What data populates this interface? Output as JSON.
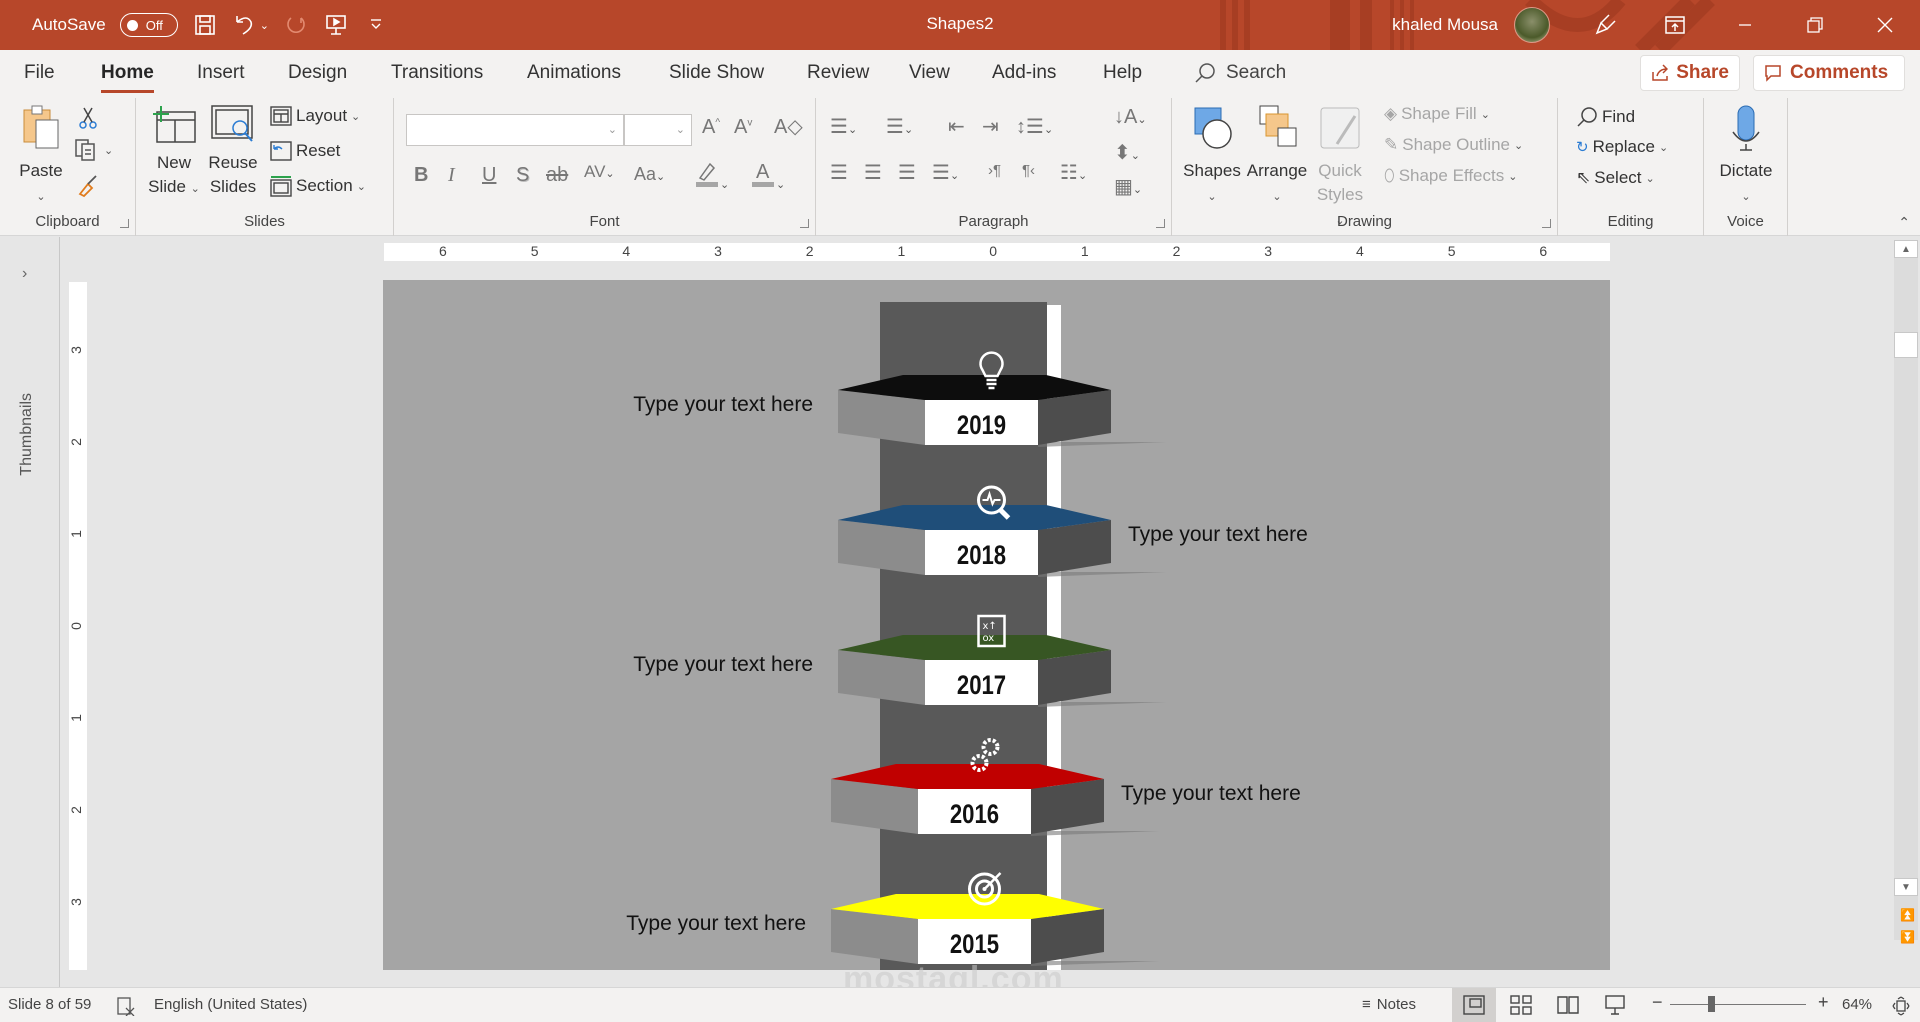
{
  "titlebar": {
    "autosave_label": "AutoSave",
    "autosave_state": "Off",
    "doc_title": "Shapes2",
    "user_name": "khaled Mousa",
    "brand_color": "#b7472a"
  },
  "tabs": [
    {
      "label": "File"
    },
    {
      "label": "Home",
      "active": true
    },
    {
      "label": "Insert"
    },
    {
      "label": "Design"
    },
    {
      "label": "Transitions"
    },
    {
      "label": "Animations"
    },
    {
      "label": "Slide Show"
    },
    {
      "label": "Review"
    },
    {
      "label": "View"
    },
    {
      "label": "Add-ins"
    },
    {
      "label": "Help"
    }
  ],
  "search": {
    "label": "Search"
  },
  "share_label": "Share",
  "comments_label": "Comments",
  "ribbon": {
    "clipboard": {
      "label": "Clipboard",
      "paste": "Paste"
    },
    "slides": {
      "label": "Slides",
      "new_slide_1": "New",
      "new_slide_2": "Slide",
      "reuse_1": "Reuse",
      "reuse_2": "Slides",
      "layout": "Layout",
      "reset": "Reset",
      "section": "Section"
    },
    "font": {
      "label": "Font",
      "font_name": "",
      "font_size": "",
      "bold": "B",
      "italic": "I",
      "underline": "U",
      "shadow": "S",
      "strike": "ab",
      "spacing": "AV",
      "case": "Aa"
    },
    "paragraph": {
      "label": "Paragraph"
    },
    "drawing": {
      "label": "Drawing",
      "shapes": "Shapes",
      "arrange": "Arrange",
      "quick_1": "Quick",
      "quick_2": "Styles",
      "fill": "Shape Fill",
      "outline": "Shape Outline",
      "effects": "Shape Effects"
    },
    "editing": {
      "label": "Editing",
      "find": "Find",
      "replace": "Replace",
      "select": "Select"
    },
    "voice": {
      "label": "Voice",
      "dictate": "Dictate"
    }
  },
  "left_pane": {
    "thumbnails_label": "Thumbnails"
  },
  "hruler_ticks": [
    "6",
    "5",
    "4",
    "3",
    "2",
    "1",
    "0",
    "1",
    "2",
    "3",
    "4",
    "5",
    "6"
  ],
  "vruler_ticks": [
    "3",
    "2",
    "1",
    "0",
    "1",
    "2",
    "3"
  ],
  "slide": {
    "background": "#a5a5a5",
    "tiers": [
      {
        "year": "2019",
        "color": "#0d0d0d",
        "icon": "lightbulb-icon",
        "text": "Type your text here",
        "side": "left"
      },
      {
        "year": "2018",
        "color": "#1f4e79",
        "icon": "magnifier-pulse-icon",
        "text": "Type your text here",
        "side": "right"
      },
      {
        "year": "2017",
        "color": "#375623",
        "icon": "strategy-board-icon",
        "text": "Type your text here",
        "side": "left"
      },
      {
        "year": "2016",
        "color": "#c00000",
        "icon": "gears-icon",
        "text": "Type your text here",
        "side": "right"
      },
      {
        "year": "2015",
        "color": "#ffff00",
        "icon": "target-icon",
        "text": "Type your text here",
        "side": "left"
      }
    ]
  },
  "statusbar": {
    "slide_info": "Slide 8 of 59",
    "language": "English (United States)",
    "notes": "Notes",
    "zoom_level": "64%",
    "zoom_fraction": 0.28
  },
  "watermark": "mostaql.com"
}
